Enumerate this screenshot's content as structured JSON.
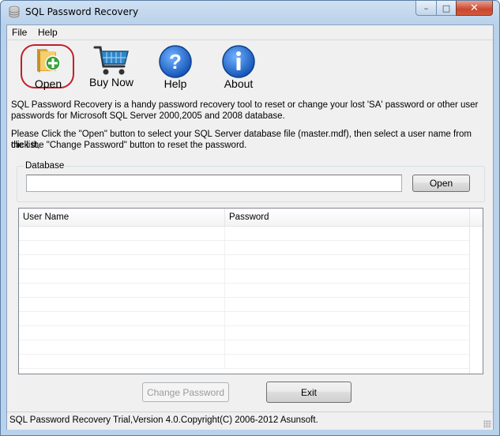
{
  "window": {
    "title": "SQL Password Recovery",
    "caption_buttons": {
      "minimize": "–",
      "maximize": "□",
      "close": "✕"
    }
  },
  "menu": {
    "items": [
      {
        "label": "File"
      },
      {
        "label": "Help"
      }
    ]
  },
  "toolbar": {
    "open_label": "Open",
    "buy_label": "Buy Now",
    "help_label": "Help",
    "about_label": "About",
    "icons": {
      "open": "folder-add-icon",
      "buy": "cart-icon",
      "help": "question-icon",
      "about": "info-icon"
    },
    "colors": {
      "highlight": "#c0202a",
      "blue": "#1f6fd6",
      "cart": "#2f86c8",
      "folder": "#e8b548",
      "plus": "#3aa33a"
    }
  },
  "description": {
    "line1": "SQL Password Recovery is a handy password recovery tool to reset or change your lost 'SA' password or other user",
    "line2": "passwords for Microsoft SQL Server 2000,2005 and 2008 database.",
    "line3": "Please Click the \"Open\" button to select your SQL Server database file (master.mdf), then select a user name from the list,",
    "line4": "click the \"Change Password\" button to reset the password."
  },
  "database": {
    "group_label": "Database",
    "path_value": "",
    "open_button": "Open"
  },
  "users_table": {
    "columns": [
      "User Name",
      "Password"
    ],
    "rows": []
  },
  "actions": {
    "change_password": "Change Password",
    "exit": "Exit"
  },
  "status": {
    "text": "SQL Password Recovery Trial,Version 4.0.Copyright(C) 2006-2012 Asunsoft."
  }
}
